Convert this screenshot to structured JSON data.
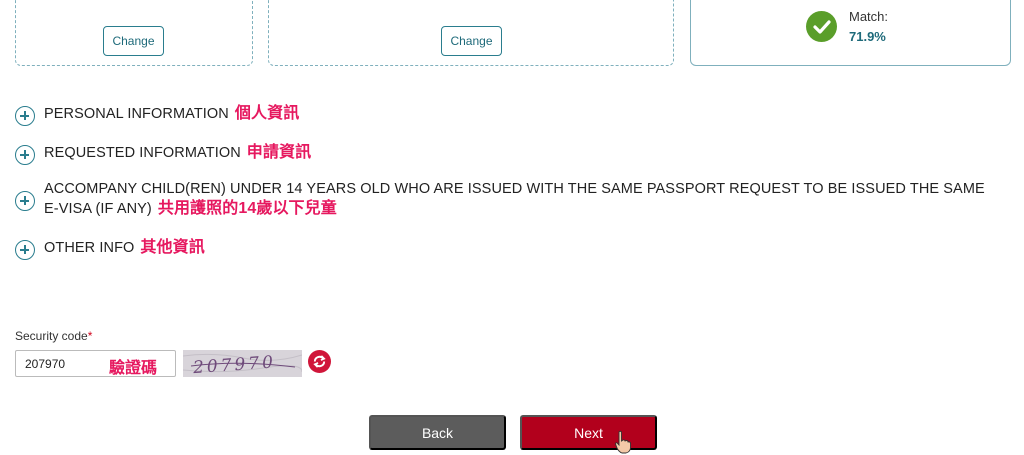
{
  "cards": {
    "change_label_1": "Change",
    "change_label_2": "Change",
    "match_label": "Match:",
    "match_value": "71.9%",
    "match_icon": "check-circle-icon",
    "match_color": "#5a9e2a"
  },
  "sections": [
    {
      "label": "PERSONAL INFORMATION",
      "zh": "個人資訊"
    },
    {
      "label": "REQUESTED INFORMATION",
      "zh": "申請資訊"
    },
    {
      "label": "ACCOMPANY CHILD(REN) UNDER 14 YEARS OLD WHO ARE ISSUED WITH THE SAME PASSPORT REQUEST TO BE ISSUED THE SAME E-VISA (IF ANY)",
      "zh": "共用護照的14歲以下兒童"
    },
    {
      "label": "OTHER INFO",
      "zh": "其他資訊"
    }
  ],
  "security": {
    "label": "Security code",
    "required_mark": "*",
    "value": "207970",
    "zh": "驗證碼",
    "captcha_text": "207970",
    "refresh_icon": "refresh-icon"
  },
  "buttons": {
    "back": "Back",
    "next": "Next"
  },
  "colors": {
    "accent": "#2a7d8e",
    "annotation": "#e6185f",
    "next_bg": "#b2001c",
    "back_bg": "#5c5c5c"
  }
}
